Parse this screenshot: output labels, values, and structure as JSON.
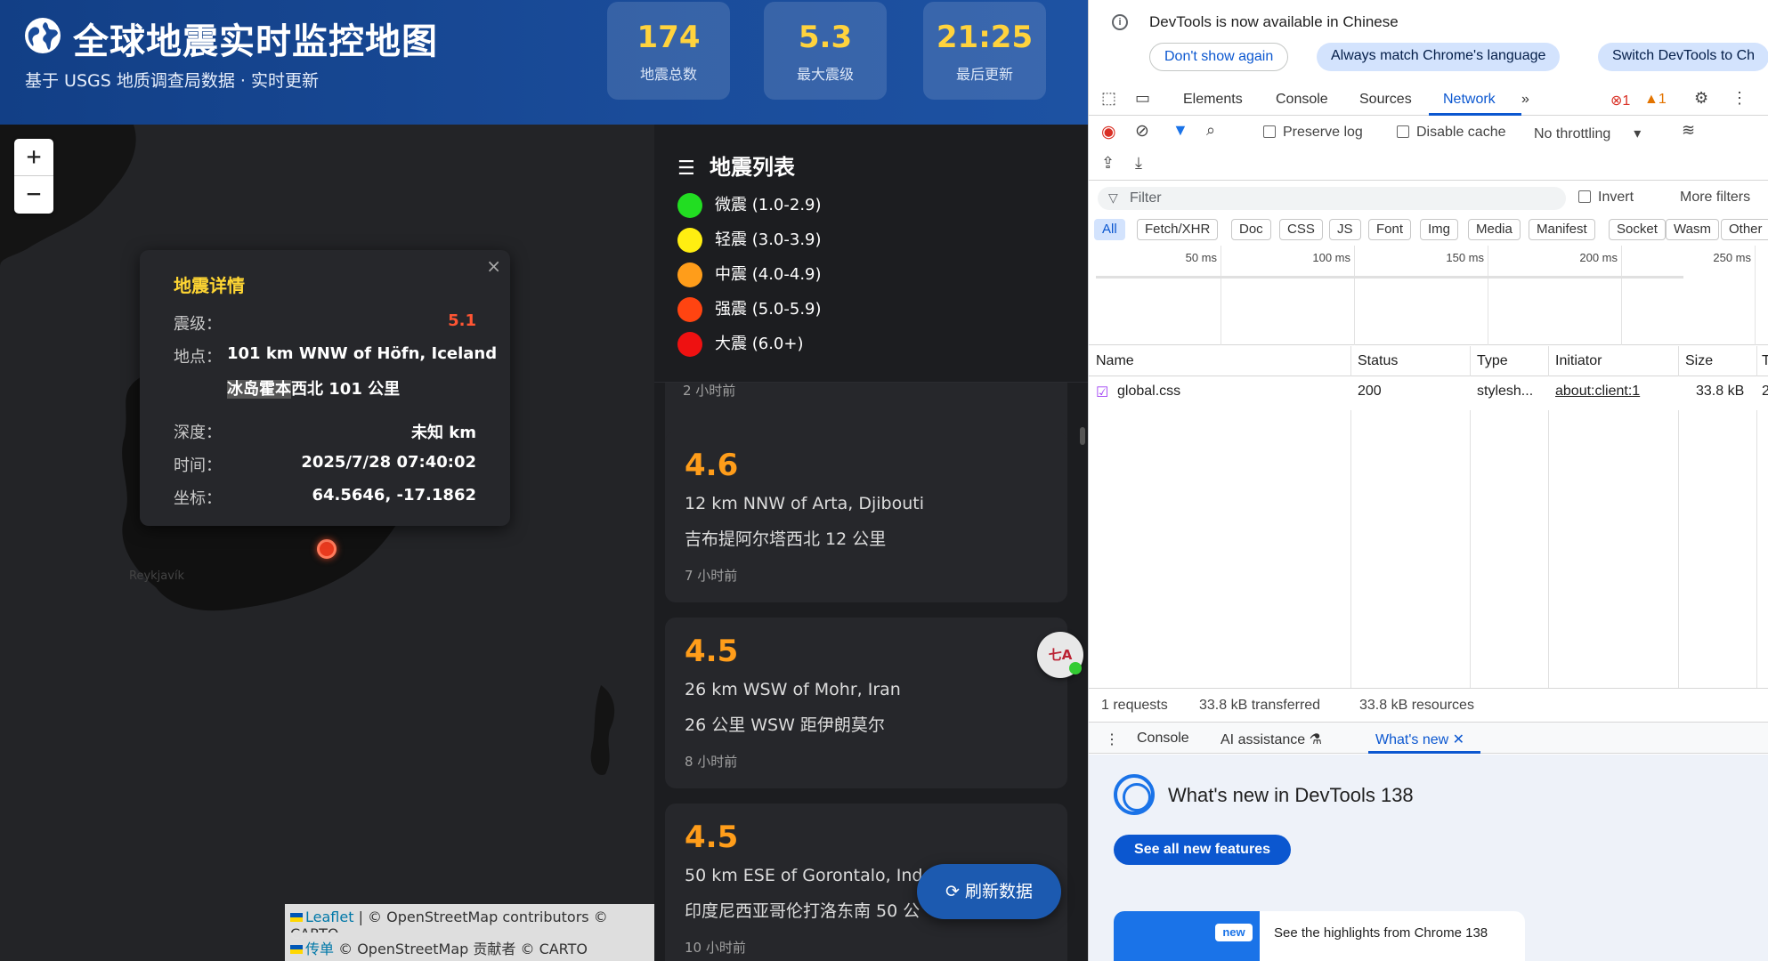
{
  "header": {
    "title": "全球地震实时监控地图",
    "subtitle": "基于 USGS 地质调查局数据 · 实时更新",
    "stats": [
      {
        "value": "174",
        "label": "地震总数"
      },
      {
        "value": "5.3",
        "label": "最大震级"
      },
      {
        "value": "21:25",
        "label": "最后更新"
      }
    ]
  },
  "map": {
    "zoom_in": "+",
    "zoom_out": "−",
    "city_label": "Reykjavík",
    "popup": {
      "title": "地震详情",
      "close": "×",
      "mag_label": "震级：",
      "mag_value": "5.1",
      "loc_label": "地点：",
      "loc_en": "101 km WNW of Höfn, Iceland",
      "loc_cn_highlight": "冰岛霍本",
      "loc_cn_rest": "西北 101 公里",
      "depth_label": "深度：",
      "depth_value": "未知 km",
      "time_label": "时间：",
      "time_value": "2025/7/28 07:40:02",
      "coord_label": "坐标：",
      "coord_value": "64.5646, -17.1862"
    },
    "attribution": {
      "line1_link": "Leaflet",
      "line1_rest": " | © OpenStreetMap contributors © CARTO",
      "line2_link": "传单",
      "line2_rest": " © OpenStreetMap 贡献者 © CARTO"
    }
  },
  "list": {
    "title": "地震列表",
    "legend": [
      {
        "label": "微震 (1.0-2.9)",
        "color": "#22dd22"
      },
      {
        "label": "轻震 (3.0-3.9)",
        "color": "#ffee11"
      },
      {
        "label": "中震 (4.0-4.9)",
        "color": "#ff9d1a"
      },
      {
        "label": "强震 (5.0-5.9)",
        "color": "#ff4411"
      },
      {
        "label": "大震 (6.0+)",
        "color": "#ee1111"
      }
    ],
    "partial_time": "2 小时前",
    "cards": [
      {
        "mag": "4.6",
        "place_en": "12 km NNW of Arta, Djibouti",
        "place_cn": "吉布提阿尔塔西北 12 公里",
        "time": "7 小时前"
      },
      {
        "mag": "4.5",
        "place_en": "26 km WSW of Mohr, Iran",
        "place_cn": "26 公里 WSW 距伊朗莫尔",
        "time": "8 小时前"
      },
      {
        "mag": "4.5",
        "place_en": "50 km ESE of Gorontalo, Indo",
        "place_cn": "印度尼西亚哥伦打洛东南 50 公",
        "time": "10 小时前"
      }
    ],
    "refresh_label": "刷新数据",
    "translate_badge": "七A"
  },
  "devtools": {
    "info_message": "DevTools is now available in Chinese",
    "info_buttons": [
      "Don't show again",
      "Always match Chrome's language",
      "Switch DevTools to Ch"
    ],
    "tabs": [
      "Elements",
      "Console",
      "Sources",
      "Network"
    ],
    "more_tabs": "»",
    "errors": "1",
    "warnings": "1",
    "preserve_log": "Preserve log",
    "disable_cache": "Disable cache",
    "throttling": "No throttling",
    "filter_placeholder": "Filter",
    "invert": "Invert",
    "more_filters": "More filters",
    "type_filters": [
      "All",
      "Fetch/XHR",
      "Doc",
      "CSS",
      "JS",
      "Font",
      "Img",
      "Media",
      "Manifest",
      "Socket",
      "Wasm",
      "Other"
    ],
    "timeline_ticks": [
      "50 ms",
      "100 ms",
      "150 ms",
      "200 ms",
      "250 ms"
    ],
    "columns": [
      "Name",
      "Status",
      "Type",
      "Initiator",
      "Size",
      "T"
    ],
    "rows": [
      {
        "name": "global.css",
        "status": "200",
        "type": "stylesh...",
        "initiator": "about:client:1",
        "size": "33.8 kB",
        "time": "2"
      }
    ],
    "summary": {
      "requests": "1 requests",
      "transferred": "33.8 kB transferred",
      "resources": "33.8 kB resources"
    },
    "drawer_tabs": [
      "Console",
      "AI assistance",
      "What's new"
    ],
    "whats_new": {
      "title": "What's new in DevTools 138",
      "button": "See all new features",
      "badge": "new",
      "card_text": "See the highlights from Chrome 138"
    }
  }
}
